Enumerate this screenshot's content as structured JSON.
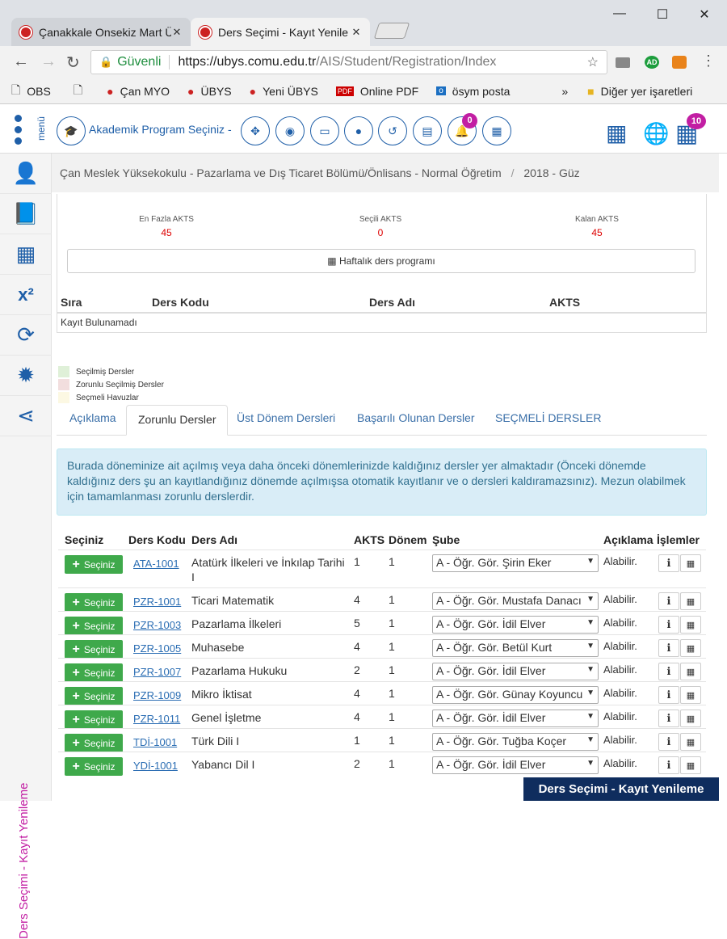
{
  "browser": {
    "tabs": [
      {
        "title": "Çanakkale Onsekiz Mart Ü"
      },
      {
        "title": "Ders Seçimi - Kayıt Yenile"
      }
    ],
    "secure_label": "Güvenli",
    "url_host": "https://ubys.comu.edu.tr",
    "url_path": "/AIS/Student/Registration/Index",
    "bookmarks": [
      "OBS",
      "",
      "Çan MYO",
      "ÜBYS",
      "Yeni ÜBYS",
      "Online PDF",
      "ösym posta"
    ],
    "bookmarks_more": "»",
    "other_bookmarks": "Diğer yer işaretleri",
    "ext_badge": "AD"
  },
  "header": {
    "menu_label": "menü",
    "program_select": "Akademik Program Seçiniz -",
    "notifications_count": "0",
    "apps_count": "10"
  },
  "breadcrumb": {
    "text": "Çan Meslek Yüksekokulu - Pazarlama ve Dış Ticaret Bölümü/Önlisans - Normal Öğretim",
    "sep": "/",
    "term": "2018 - Güz"
  },
  "summary": {
    "max_akts_label": "En Fazla AKTS",
    "max_akts": "45",
    "selected_akts_label": "Seçili AKTS",
    "selected_akts": "0",
    "remaining_akts_label": "Kalan AKTS",
    "remaining_akts": "45",
    "weekly_button": "Haftalık ders programı",
    "columns": [
      "Sıra",
      "Ders Kodu",
      "Ders Adı",
      "AKTS"
    ],
    "empty_text": "Kayıt Bulunamadı"
  },
  "legend": [
    {
      "label": "Seçilmiş Dersler",
      "color": "#dff0d8"
    },
    {
      "label": "Zorunlu Seçilmiş Dersler",
      "color": "#f2dede"
    },
    {
      "label": "Seçmeli Havuzlar",
      "color": "#fcf8e3"
    }
  ],
  "tabs": [
    "Açıklama",
    "Zorunlu Dersler",
    "Üst Dönem Dersleri",
    "Başarılı Olunan Dersler",
    "SEÇMELİ DERSLER"
  ],
  "active_tab": "Zorunlu Dersler",
  "info_text": "Burada döneminize ait açılmış veya daha önceki dönemlerinizde kaldığınız dersler yer almaktadır (Önceki dönemde kaldığınız ders şu an kayıtlandığınız dönemde açılmışsa otomatik kayıtlanır ve o dersleri kaldıramazsınız). Mezun olabilmek için tamamlanması zorunlu derslerdir.",
  "table": {
    "headers": [
      "Seçiniz",
      "Ders Kodu",
      "Ders Adı",
      "AKTS",
      "Dönem",
      "Şube",
      "Açıklama",
      "İşlemler"
    ],
    "select_label": "Seçiniz",
    "rows": [
      {
        "code": "ATA-1001",
        "name": "Atatürk İlkeleri ve İnkılap Tarihi I",
        "akts": "1",
        "donem": "1",
        "sube": "A - Öğr. Gör. Şirin Eker",
        "aciklama": "Alabilir."
      },
      {
        "code": "PZR-1001",
        "name": "Ticari Matematik",
        "akts": "4",
        "donem": "1",
        "sube": "A - Öğr. Gör. Mustafa Danacı",
        "aciklama": "Alabilir."
      },
      {
        "code": "PZR-1003",
        "name": "Pazarlama İlkeleri",
        "akts": "5",
        "donem": "1",
        "sube": "A - Öğr. Gör. İdil Elver",
        "aciklama": "Alabilir."
      },
      {
        "code": "PZR-1005",
        "name": "Muhasebe",
        "akts": "4",
        "donem": "1",
        "sube": "A - Öğr. Gör. Betül Kurt",
        "aciklama": "Alabilir."
      },
      {
        "code": "PZR-1007",
        "name": "Pazarlama Hukuku",
        "akts": "2",
        "donem": "1",
        "sube": "A - Öğr. Gör. İdil Elver",
        "aciklama": "Alabilir."
      },
      {
        "code": "PZR-1009",
        "name": "Mikro İktisat",
        "akts": "4",
        "donem": "1",
        "sube": "A - Öğr. Gör. Günay Koyuncu",
        "aciklama": "Alabilir."
      },
      {
        "code": "PZR-1011",
        "name": "Genel İşletme",
        "akts": "4",
        "donem": "1",
        "sube": "A - Öğr. Gör. İdil Elver",
        "aciklama": "Alabilir."
      },
      {
        "code": "TDİ-1001",
        "name": "Türk Dili I",
        "akts": "1",
        "donem": "1",
        "sube": "A - Öğr. Gör. Tuğba Koçer",
        "aciklama": "Alabilir."
      },
      {
        "code": "YDİ-1001",
        "name": "Yabancı Dil I",
        "akts": "2",
        "donem": "1",
        "sube": "A - Öğr. Gör. İdil Elver",
        "aciklama": "Alabilir."
      }
    ]
  },
  "side_label": "Ders Seçimi - Kayıt Yenileme",
  "footer_label": "Ders Seçimi - Kayıt Yenileme",
  "colors": {
    "primary": "#1f5fa8",
    "magenta": "#c21ea3",
    "green": "#3fa94b",
    "navy": "#0f2d5e"
  }
}
